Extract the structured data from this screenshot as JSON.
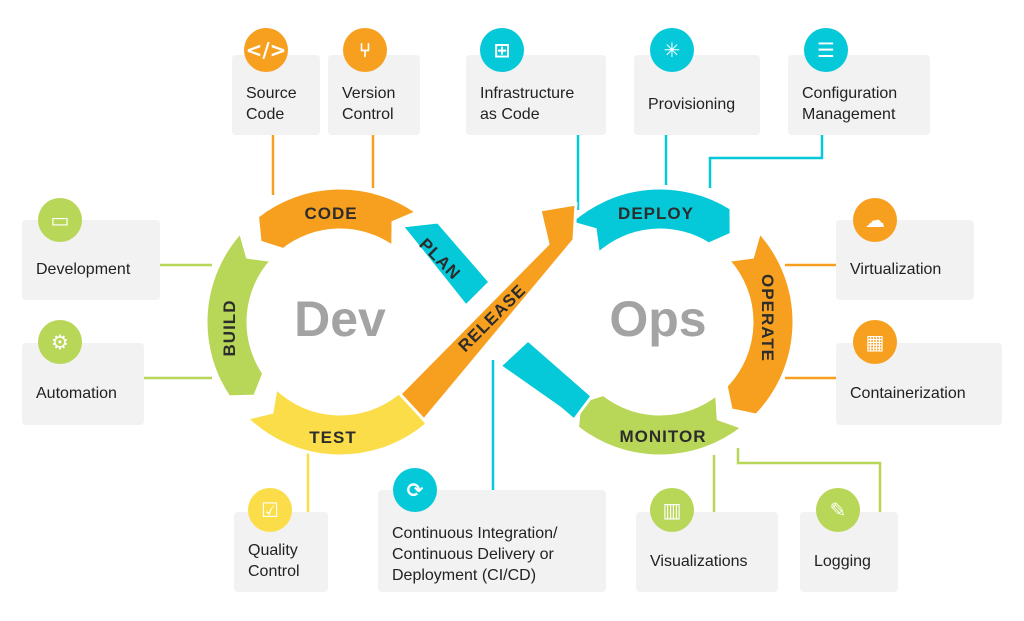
{
  "colors": {
    "orange": "#F7A020",
    "cyan": "#05C8D8",
    "green": "#B8D657",
    "yellow": "#FBDD4A",
    "text": "#2c2c2c",
    "center_text": "#A3A3A3",
    "card": "#F2F2F2"
  },
  "center": {
    "left": "Dev",
    "right": "Ops"
  },
  "stages": {
    "code": "CODE",
    "plan": "PLAN",
    "build": "BUILD",
    "test": "TEST",
    "release": "RELEASE",
    "deploy": "DEPLOY",
    "operate": "OPERATE",
    "monitor": "MONITOR"
  },
  "cards": [
    {
      "label": "Source\nCode",
      "icon": "code-brackets-icon",
      "color": "#F7A020"
    },
    {
      "label": "Version\nControl",
      "icon": "git-branch-icon",
      "color": "#F7A020"
    },
    {
      "label": "Infrastructure\nas Code",
      "icon": "network-blocks-icon",
      "color": "#05C8D8"
    },
    {
      "label": "Provisioning",
      "icon": "hub-nodes-icon",
      "color": "#05C8D8"
    },
    {
      "label": "Configuration\nManagement",
      "icon": "sliders-icon",
      "color": "#05C8D8"
    },
    {
      "label": "Development",
      "icon": "monitor-code-icon",
      "color": "#B8D657"
    },
    {
      "label": "Automation",
      "icon": "gear-icon",
      "color": "#B8D657"
    },
    {
      "label": "Virtualization",
      "icon": "cloud-icon",
      "color": "#F7A020"
    },
    {
      "label": "Containerization",
      "icon": "container-icon",
      "color": "#F7A020"
    },
    {
      "label": "Quality\nControl",
      "icon": "checklist-icon",
      "color": "#FBDD4A"
    },
    {
      "label": "Continuous Integration/\nContinuous Delivery or\nDeployment (CI/CD)",
      "icon": "cycle-arrows-icon",
      "color": "#05C8D8"
    },
    {
      "label": "Visualizations",
      "icon": "bar-chart-icon",
      "color": "#B8D657"
    },
    {
      "label": "Logging",
      "icon": "notepad-pen-icon",
      "color": "#B8D657"
    }
  ]
}
